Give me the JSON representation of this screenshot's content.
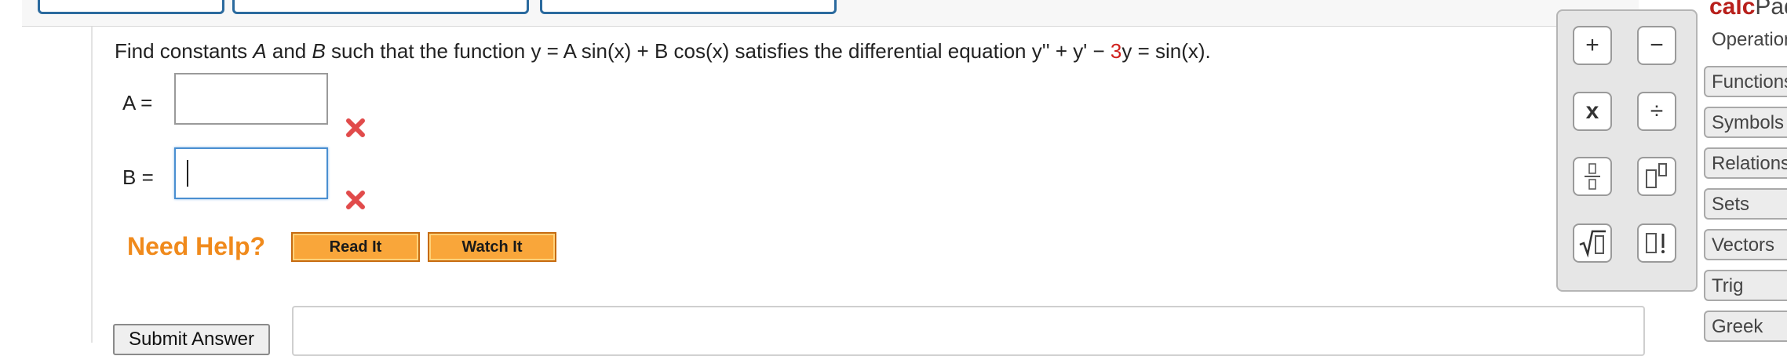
{
  "question": {
    "prefix": "Find constants ",
    "var_a": "A",
    "and": " and ",
    "var_b": "B",
    "mid": " such that the function ",
    "function_text": "y = A sin(x) + B cos(x)",
    "mid2": " satisfies the differential equation ",
    "de_left": "y'' + y' − ",
    "de_coef": "3",
    "de_right": "y = sin(x)."
  },
  "answers": [
    {
      "label": "A =",
      "value": "",
      "status": "incorrect"
    },
    {
      "label": "B =",
      "value": "",
      "status": "incorrect"
    }
  ],
  "help": {
    "label": "Need Help?",
    "read_it": "Read It",
    "watch_it": "Watch It"
  },
  "submit_label": "Submit Answer",
  "calcpad": {
    "title_1": "calc",
    "title_2": "Pad",
    "keys": [
      {
        "icon": "plus-icon",
        "text": "+"
      },
      {
        "icon": "minus-icon",
        "text": "−"
      },
      {
        "icon": "multiply-icon",
        "text": "x"
      },
      {
        "icon": "divide-icon",
        "text": "÷"
      },
      {
        "icon": "fraction-icon",
        "text": "▯/▯"
      },
      {
        "icon": "exponent-icon",
        "text": "▯▯"
      },
      {
        "icon": "sqrt-icon",
        "text": "√▯"
      },
      {
        "icon": "factorial-icon",
        "text": "▯!"
      }
    ],
    "tabs": [
      "Operations",
      "Functions",
      "Symbols",
      "Relations",
      "Sets",
      "Vectors",
      "Trig",
      "Greek"
    ]
  },
  "colors": {
    "accent_red": "#d0201c",
    "help_orange": "#f08a1c",
    "button_orange": "#f9a63a",
    "focus_blue": "#4a8fd1"
  }
}
